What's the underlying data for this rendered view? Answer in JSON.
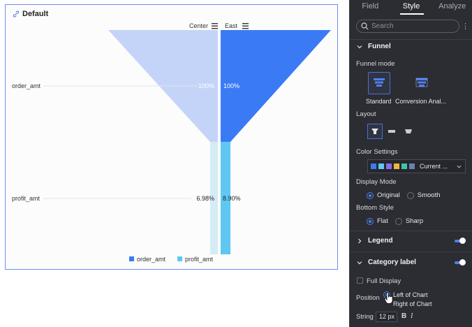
{
  "chart_card": {
    "title": "Default"
  },
  "chart_data": {
    "type": "funnel",
    "title": "Default",
    "columns": [
      "Center",
      "East"
    ],
    "categories": [
      "order_amt",
      "profit_amt"
    ],
    "series": [
      {
        "name": "Center",
        "labels": [
          "100%",
          "6.98%"
        ],
        "values": [
          100,
          6.98
        ]
      },
      {
        "name": "East",
        "labels": [
          "100%",
          "8.90%"
        ],
        "values": [
          100,
          8.9
        ]
      }
    ],
    "legend": [
      {
        "name": "order_amt",
        "color": "#3b7af5"
      },
      {
        "name": "profit_amt",
        "color": "#5ec8f2"
      }
    ],
    "legend_position": "bottom",
    "category_label_position": "left",
    "colors": {
      "center_order": "#c4d4f9",
      "east_order": "#3b7af5",
      "center_profit": "#d4ecf5",
      "east_profit": "#5ec8f2"
    }
  },
  "panel": {
    "tabs": [
      {
        "label": "Field"
      },
      {
        "label": "Style"
      },
      {
        "label": "Analyze"
      }
    ],
    "active_tab": "Style",
    "search_placeholder": "Search",
    "funnel": {
      "heading": "Funnel",
      "mode_label": "Funnel mode",
      "modes": [
        "Standard",
        "Conversion Anal..."
      ],
      "layout_label": "Layout",
      "color_label": "Color Settings",
      "color_value": "Current ...",
      "swatches": [
        "#3b7af5",
        "#5ec8f2",
        "#8a6be8",
        "#f2b43c",
        "#3ec6a0",
        "#6b7fb0"
      ],
      "display_mode_label": "Display Mode",
      "display_options": [
        "Original",
        "Smooth"
      ],
      "bottom_style_label": "Bottom Style",
      "bottom_options": [
        "Flat",
        "Sharp"
      ]
    },
    "legend": {
      "heading": "Legend",
      "enabled": true
    },
    "category_label": {
      "heading": "Category label",
      "enabled": true,
      "full_display": "Full Display",
      "position_label": "Position",
      "position_options": [
        "Left of Chart",
        "Right of Chart"
      ],
      "string_label": "String",
      "font_size": "12 px",
      "bold": "B",
      "italic": "I"
    }
  }
}
